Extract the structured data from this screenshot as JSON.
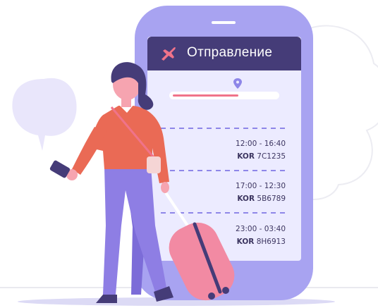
{
  "header": {
    "title": "Отправление",
    "icon": "airplane-icon"
  },
  "flights": [
    {
      "time": "12:00 - 16:40",
      "airline": "KOR",
      "number": "7C1235"
    },
    {
      "time": "17:00 - 12:30",
      "airline": "KOR",
      "number": "5B6789"
    },
    {
      "time": "23:00 - 03:40",
      "airline": "KOR",
      "number": "8H6913"
    }
  ],
  "colors": {
    "phone_body": "#a8a3f1",
    "screen": "#ecebff",
    "header": "#453c78",
    "accent_pink": "#f0738a",
    "shirt": "#ea6a55",
    "pants": "#8e7ee4",
    "suitcase": "#f28aa3"
  }
}
